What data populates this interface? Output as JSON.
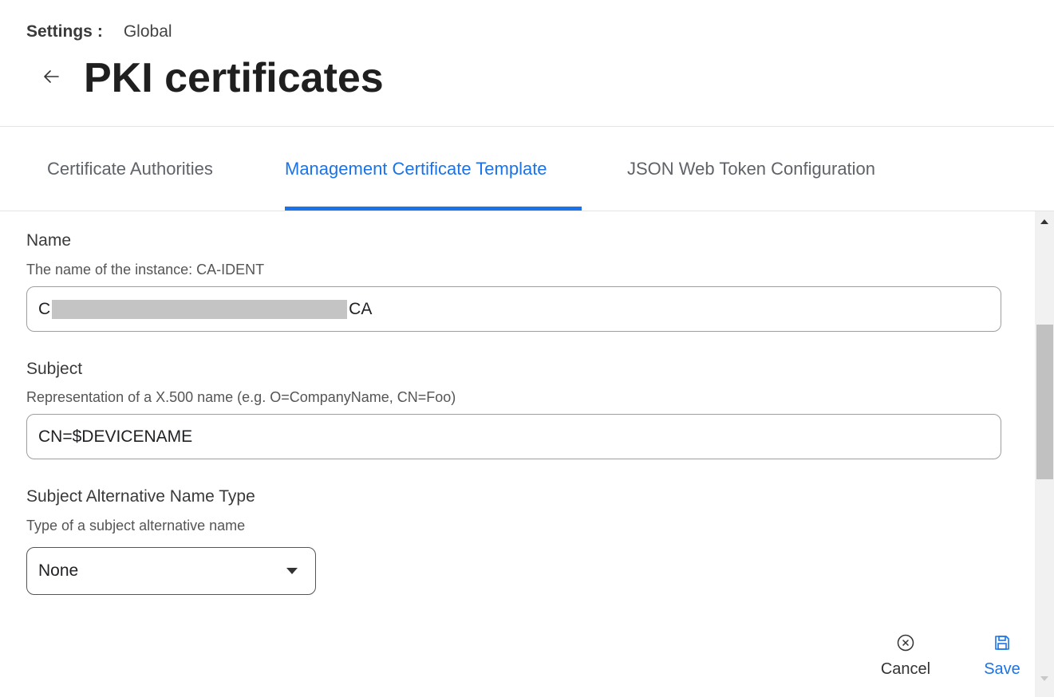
{
  "breadcrumb": {
    "root": "Settings",
    "separator": ":",
    "current": "Global"
  },
  "page": {
    "title": "PKI certificates"
  },
  "tabs": [
    {
      "label": "Certificate Authorities",
      "active": false
    },
    {
      "label": "Management Certificate Template",
      "active": true
    },
    {
      "label": "JSON Web Token Configuration",
      "active": false
    }
  ],
  "form": {
    "name": {
      "label": "Name",
      "help": "The name of the instance: CA-IDENT",
      "value_prefix": "C",
      "value_suffix": "CA"
    },
    "subject": {
      "label": "Subject",
      "help": "Representation of a X.500 name (e.g. O=CompanyName, CN=Foo)",
      "value": "CN=$DEVICENAME"
    },
    "san_type": {
      "label": "Subject Alternative Name Type",
      "help": "Type of a subject alternative name",
      "selected": "None"
    }
  },
  "actions": {
    "cancel": "Cancel",
    "save": "Save"
  },
  "colors": {
    "accent": "#1a73e8",
    "text": "#202124",
    "muted": "#5f6368"
  },
  "icons": {
    "back": "arrow-left-icon",
    "cancel": "circle-x-icon",
    "save": "floppy-disk-icon",
    "dropdown": "caret-down-icon"
  }
}
